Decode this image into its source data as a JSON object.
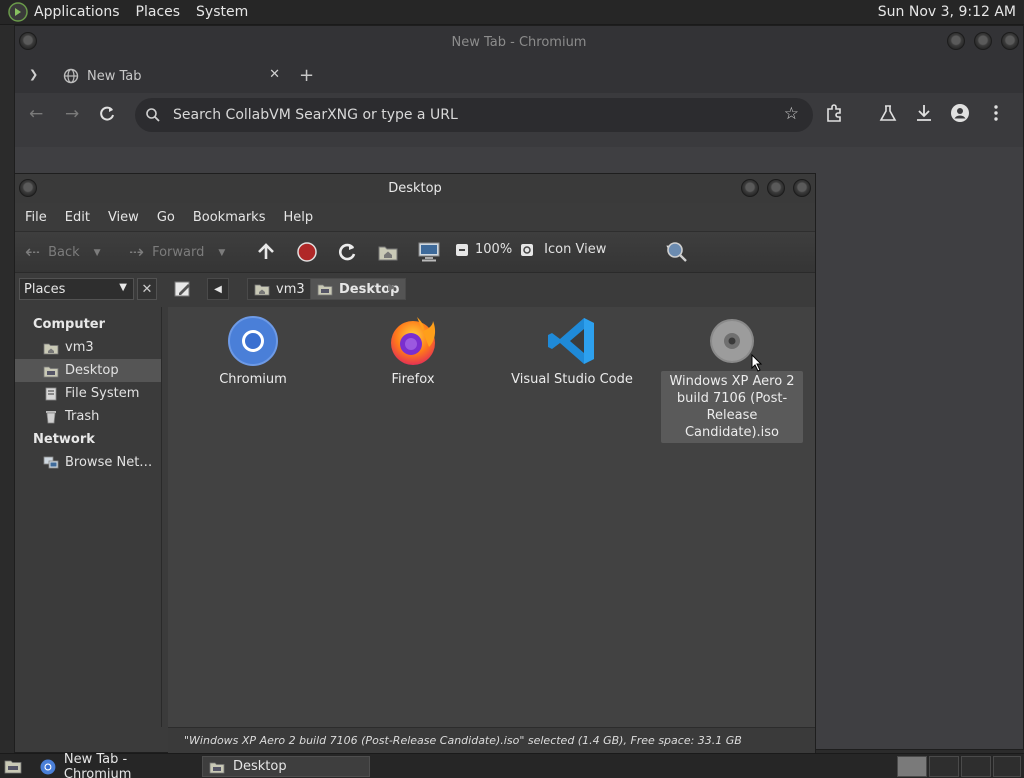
{
  "top_panel": {
    "menus": [
      "Applications",
      "Places",
      "System"
    ],
    "clock": "Sun Nov  3,  9:12 AM"
  },
  "browser": {
    "window_title": "New Tab - Chromium",
    "tab_title": "New Tab",
    "omnibox_placeholder": "Search CollabVM SearXNG or type a URL"
  },
  "file_manager": {
    "window_title": "Desktop",
    "menus": [
      "File",
      "Edit",
      "View",
      "Go",
      "Bookmarks",
      "Help"
    ],
    "toolbar": {
      "back": "Back",
      "forward": "Forward",
      "zoom": "100%",
      "view_mode": "Icon View"
    },
    "sidebar_selector": "Places",
    "breadcrumbs": [
      "vm3",
      "Desktop"
    ],
    "sidebar": {
      "computer_header": "Computer",
      "computer_items": [
        "vm3",
        "Desktop",
        "File System",
        "Trash"
      ],
      "network_header": "Network",
      "network_items": [
        "Browse Net…"
      ]
    },
    "desktop_items": [
      {
        "label": "Chromium",
        "icon": "chromium-icon"
      },
      {
        "label": "Firefox",
        "icon": "firefox-icon"
      },
      {
        "label": "Visual Studio Code",
        "icon": "vscode-icon"
      },
      {
        "label": "Windows XP Aero 2 build 7106 (Post-Release Candidate).iso",
        "icon": "disc-image-icon"
      }
    ],
    "status": "\"Windows XP Aero 2 build 7106 (Post-Release Candidate).iso\" selected (1.4 GB), Free space: 33.1 GB"
  },
  "taskbar": {
    "items": [
      "New Tab - Chromium",
      "Desktop"
    ]
  }
}
